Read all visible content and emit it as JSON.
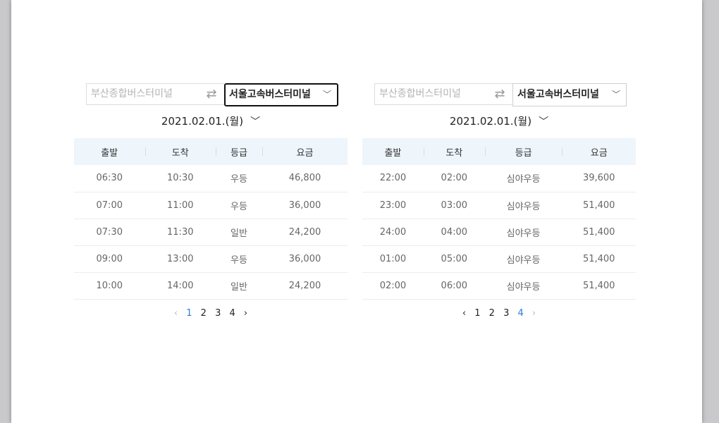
{
  "panels": [
    {
      "from_placeholder": "부산종합버스터미널",
      "to": "서울고속버스터미널",
      "date": "2021.02.01.(월)",
      "headers": [
        "출발",
        "도착",
        "등급",
        "요금"
      ],
      "rows": [
        [
          "06:30",
          "10:30",
          "우등",
          "46,800"
        ],
        [
          "07:00",
          "11:00",
          "우등",
          "36,000"
        ],
        [
          "07:30",
          "11:30",
          "일반",
          "24,200"
        ],
        [
          "09:00",
          "13:00",
          "우등",
          "36,000"
        ],
        [
          "10:00",
          "14:00",
          "일반",
          "24,200"
        ]
      ],
      "pages": [
        "1",
        "2",
        "3",
        "4"
      ],
      "current_page": "1"
    },
    {
      "from_placeholder": "부산종합버스터미널",
      "to": "서울고속버스터미널",
      "date": "2021.02.01.(월)",
      "headers": [
        "출발",
        "도착",
        "등급",
        "요금"
      ],
      "rows": [
        [
          "22:00",
          "02:00",
          "심야우등",
          "39,600"
        ],
        [
          "23:00",
          "03:00",
          "심야우등",
          "51,400"
        ],
        [
          "24:00",
          "04:00",
          "심야우등",
          "51,400"
        ],
        [
          "01:00",
          "05:00",
          "심야우등",
          "51,400"
        ],
        [
          "02:00",
          "06:00",
          "심야우등",
          "51,400"
        ]
      ],
      "pages": [
        "1",
        "2",
        "3",
        "4"
      ],
      "current_page": "4"
    }
  ],
  "icons": {
    "swap": "swap-arrows-icon",
    "dropdown": "chevron-down-icon",
    "prev": "chevron-left-icon",
    "next": "chevron-right-icon"
  }
}
